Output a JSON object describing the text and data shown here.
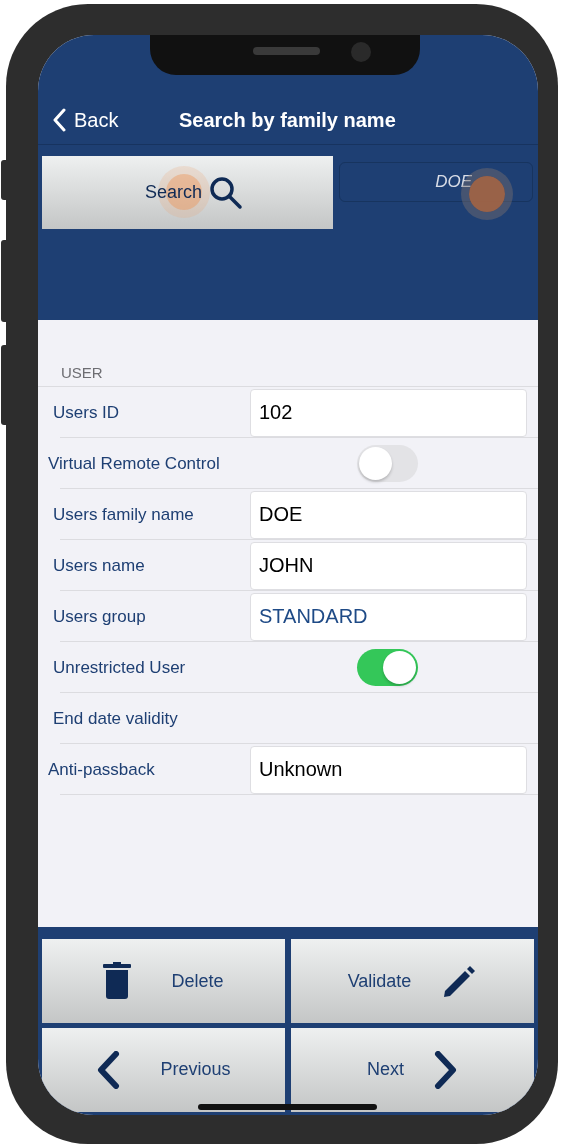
{
  "nav": {
    "back_label": "Back",
    "title": "Search by family name"
  },
  "search": {
    "button_label": "Search",
    "field_value": "DOE"
  },
  "section": {
    "header": "USER",
    "rows": [
      {
        "kind": "text",
        "label": "Users ID",
        "value": "102"
      },
      {
        "kind": "switch",
        "label": "Virtual Remote Control",
        "on": false
      },
      {
        "kind": "text",
        "label": "Users family name",
        "value": "DOE"
      },
      {
        "kind": "text",
        "label": "Users name",
        "value": "JOHN"
      },
      {
        "kind": "picker",
        "label": "Users group",
        "value": "STANDARD"
      },
      {
        "kind": "switch",
        "label": "Unrestricted User",
        "on": true
      },
      {
        "kind": "plain",
        "label": "End date validity"
      },
      {
        "kind": "text",
        "label": "Anti-passback",
        "value": "Unknown"
      }
    ]
  },
  "toolbar": [
    {
      "kind": "delete",
      "label": "Delete"
    },
    {
      "kind": "validate",
      "label": "Validate"
    },
    {
      "kind": "previous",
      "label": "Previous"
    },
    {
      "kind": "next",
      "label": "Next"
    }
  ]
}
